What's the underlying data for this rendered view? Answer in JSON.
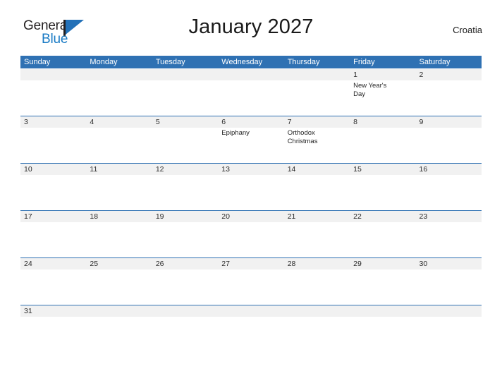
{
  "brand": {
    "name_part1": "General",
    "name_part2": "Blue",
    "mark": "flag-triangle"
  },
  "header": {
    "title": "January 2027",
    "country": "Croatia"
  },
  "colors": {
    "header_blue": "#2f71b3",
    "rule_blue": "#2f71b3",
    "date_band_gray": "#f1f1f1",
    "brand_blue": "#1a7bc5",
    "text_dark": "#1a1a1a"
  },
  "calendar": {
    "weekday_labels": [
      "Sunday",
      "Monday",
      "Tuesday",
      "Wednesday",
      "Thursday",
      "Friday",
      "Saturday"
    ],
    "weeks": [
      {
        "days": [
          {
            "num": "",
            "events": []
          },
          {
            "num": "",
            "events": []
          },
          {
            "num": "",
            "events": []
          },
          {
            "num": "",
            "events": []
          },
          {
            "num": "",
            "events": []
          },
          {
            "num": "1",
            "events": [
              "New Year's Day"
            ]
          },
          {
            "num": "2",
            "events": []
          }
        ]
      },
      {
        "days": [
          {
            "num": "3",
            "events": []
          },
          {
            "num": "4",
            "events": []
          },
          {
            "num": "5",
            "events": []
          },
          {
            "num": "6",
            "events": [
              "Epiphany"
            ]
          },
          {
            "num": "7",
            "events": [
              "Orthodox Christmas"
            ]
          },
          {
            "num": "8",
            "events": []
          },
          {
            "num": "9",
            "events": []
          }
        ]
      },
      {
        "days": [
          {
            "num": "10",
            "events": []
          },
          {
            "num": "11",
            "events": []
          },
          {
            "num": "12",
            "events": []
          },
          {
            "num": "13",
            "events": []
          },
          {
            "num": "14",
            "events": []
          },
          {
            "num": "15",
            "events": []
          },
          {
            "num": "16",
            "events": []
          }
        ]
      },
      {
        "days": [
          {
            "num": "17",
            "events": []
          },
          {
            "num": "18",
            "events": []
          },
          {
            "num": "19",
            "events": []
          },
          {
            "num": "20",
            "events": []
          },
          {
            "num": "21",
            "events": []
          },
          {
            "num": "22",
            "events": []
          },
          {
            "num": "23",
            "events": []
          }
        ]
      },
      {
        "days": [
          {
            "num": "24",
            "events": []
          },
          {
            "num": "25",
            "events": []
          },
          {
            "num": "26",
            "events": []
          },
          {
            "num": "27",
            "events": []
          },
          {
            "num": "28",
            "events": []
          },
          {
            "num": "29",
            "events": []
          },
          {
            "num": "30",
            "events": []
          }
        ]
      },
      {
        "days": [
          {
            "num": "31",
            "events": []
          },
          {
            "num": "",
            "events": []
          },
          {
            "num": "",
            "events": []
          },
          {
            "num": "",
            "events": []
          },
          {
            "num": "",
            "events": []
          },
          {
            "num": "",
            "events": []
          },
          {
            "num": "",
            "events": []
          }
        ]
      }
    ]
  }
}
